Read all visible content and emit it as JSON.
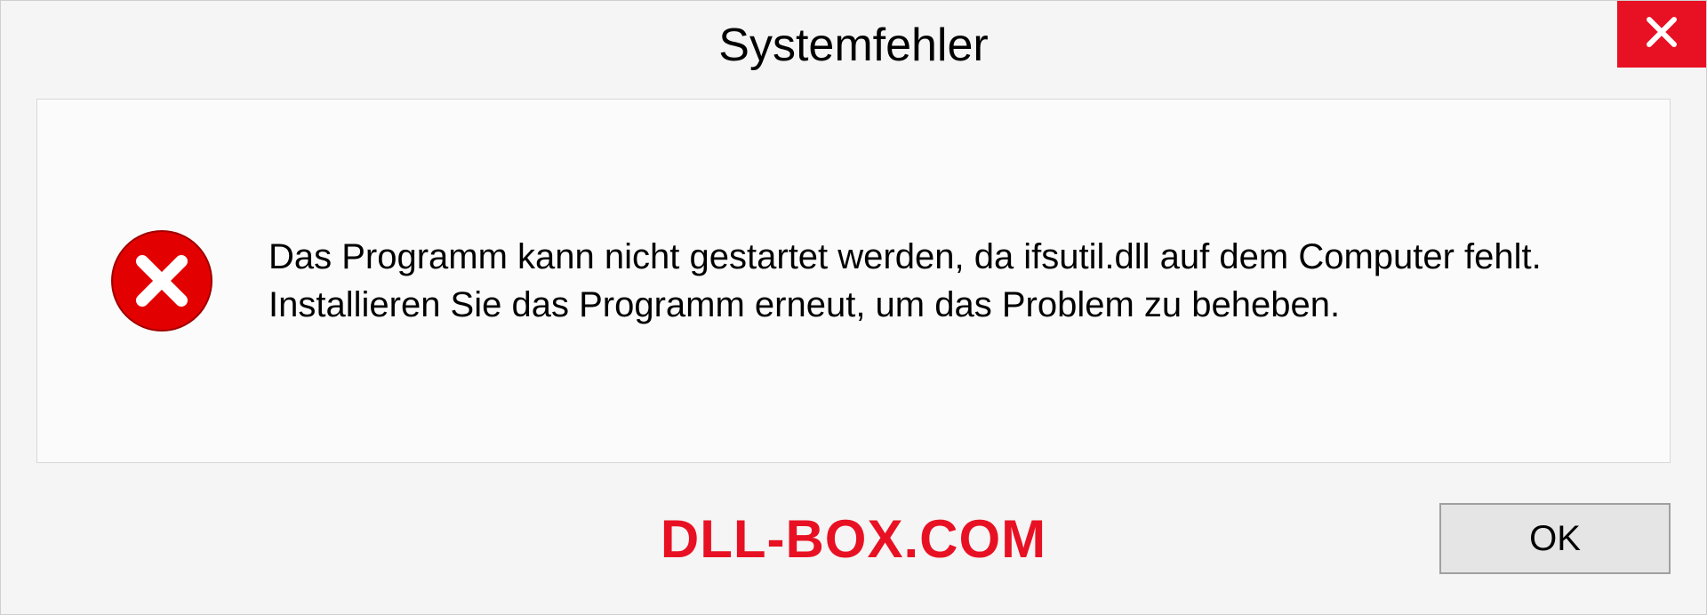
{
  "dialog": {
    "title": "Systemfehler",
    "message": "Das Programm kann nicht gestartet werden, da ifsutil.dll auf dem Computer fehlt. Installieren Sie das Programm erneut, um das Problem zu beheben.",
    "ok_label": "OK"
  },
  "watermark": "DLL-BOX.COM",
  "colors": {
    "close_button": "#e81123",
    "error_icon": "#e20000",
    "watermark": "#e81123"
  }
}
